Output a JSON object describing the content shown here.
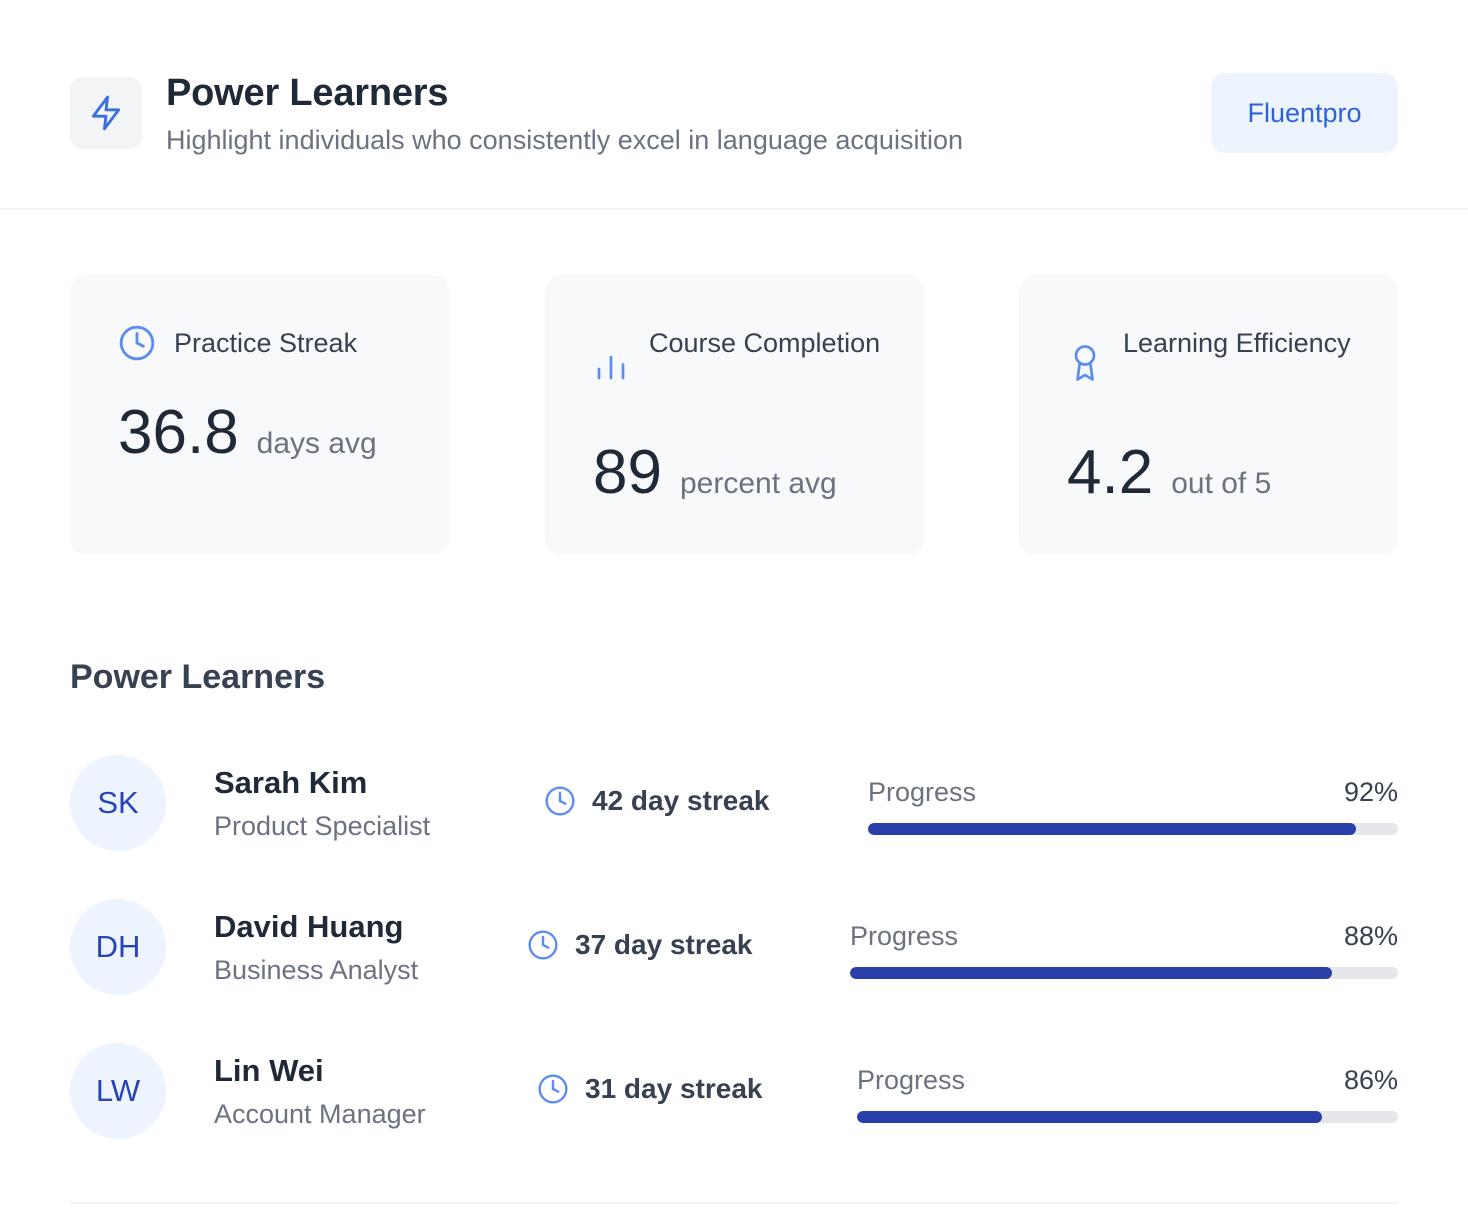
{
  "header": {
    "title": "Power Learners",
    "subtitle": "Highlight individuals who consistently excel in language acquisition",
    "brand_button": "Fluentpro",
    "icon": "lightning-bolt-icon"
  },
  "stats": [
    {
      "icon": "clock-icon",
      "label": "Practice Streak",
      "value": "36.8",
      "unit": "days avg"
    },
    {
      "icon": "bar-chart-icon",
      "label": "Course Completion",
      "value": "89",
      "unit": "percent avg"
    },
    {
      "icon": "award-icon",
      "label": "Learning Efficiency",
      "value": "4.2",
      "unit": "out of 5"
    }
  ],
  "section_title": "Power Learners",
  "learners": [
    {
      "initials": "SK",
      "name": "Sarah Kim",
      "role": "Product Specialist",
      "streak": "42 day streak",
      "progress_label": "Progress",
      "progress_pct": "92%",
      "progress": 0.92
    },
    {
      "initials": "DH",
      "name": "David Huang",
      "role": "Business Analyst",
      "streak": "37 day streak",
      "progress_label": "Progress",
      "progress_pct": "88%",
      "progress": 0.88
    },
    {
      "initials": "LW",
      "name": "Lin Wei",
      "role": "Account Manager",
      "streak": "31 day streak",
      "progress_label": "Progress",
      "progress_pct": "86%",
      "progress": 0.86
    }
  ],
  "colors": {
    "accent": "#2e62d9",
    "icon_blue": "#5b8def",
    "progress_fill": "#2a3faa",
    "avatar_bg": "#eef4fe"
  }
}
